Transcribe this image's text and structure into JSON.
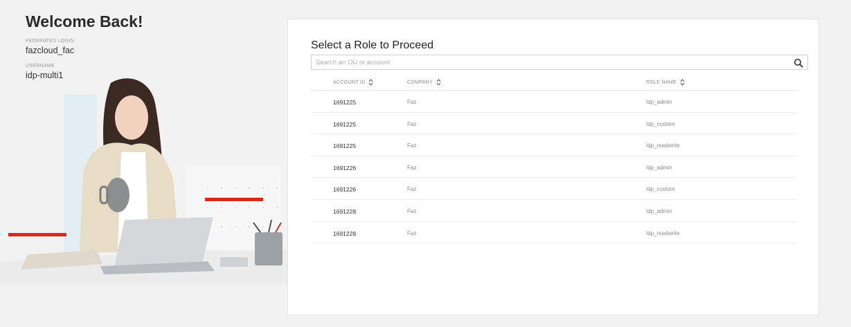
{
  "left": {
    "welcome": "Welcome Back!",
    "federated_label": "FEDERATED LOGIN",
    "federated_value": "fazcloud_fac",
    "username_label": "USERNAME",
    "username_value": "idp-multi1",
    "accent_color": "#d9291c"
  },
  "card": {
    "title": "Select a Role to Proceed",
    "search_placeholder": "Search an OU or account",
    "search_value": ""
  },
  "table": {
    "headers": {
      "account_id": "ACCOUNT ID",
      "company": "COMPANY",
      "role_name": "ROLE NAME"
    },
    "rows": [
      {
        "account_id": "1691225",
        "company": "Faz",
        "role": "Idp_admin"
      },
      {
        "account_id": "1691225",
        "company": "Faz",
        "role": "Idp_custom"
      },
      {
        "account_id": "1691225",
        "company": "Faz",
        "role": "Idp_readwrite"
      },
      {
        "account_id": "1691226",
        "company": "Faz",
        "role": "Idp_admin"
      },
      {
        "account_id": "1691226",
        "company": "Faz",
        "role": "Idp_custom"
      },
      {
        "account_id": "1691228",
        "company": "Faz",
        "role": "Idp_admin"
      },
      {
        "account_id": "1691228",
        "company": "Faz",
        "role": "Idp_readwrite"
      }
    ]
  }
}
